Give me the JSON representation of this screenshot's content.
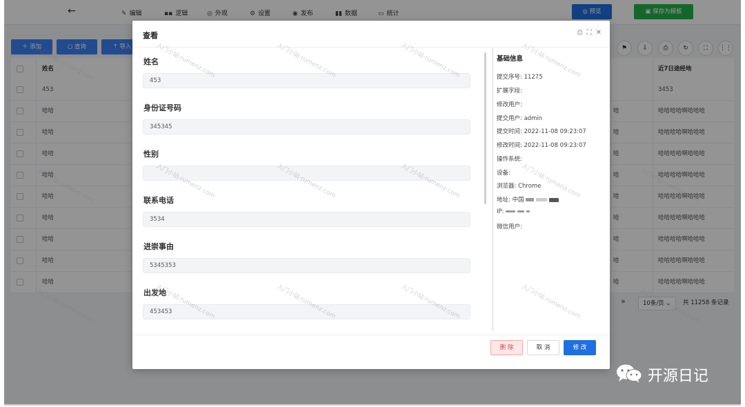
{
  "topbar": {
    "nav": [
      {
        "icon": "edit-icon",
        "glyph": "✎",
        "label": "编辑"
      },
      {
        "icon": "logic-icon",
        "glyph": "▪▪",
        "label": "逻辑"
      },
      {
        "icon": "eye-icon",
        "glyph": "◎",
        "label": "外观"
      },
      {
        "icon": "gear-icon",
        "glyph": "⚙",
        "label": "设置"
      },
      {
        "icon": "publish-icon",
        "glyph": "◉",
        "label": "发布"
      },
      {
        "icon": "bar-chart-icon",
        "glyph": "▮▮",
        "label": "数据"
      },
      {
        "icon": "stats-icon",
        "glyph": "▭",
        "label": "统计"
      }
    ],
    "preview_label": "预览",
    "save_template_label": "保存为模板"
  },
  "toolbar": {
    "add_label": "添加",
    "query_label": "查询",
    "import_label": "导入"
  },
  "table": {
    "col_name": "姓名",
    "col_route": "近7日途经地",
    "rows": [
      {
        "name": "453",
        "mid": "",
        "route": "3453"
      },
      {
        "name": "哈哈",
        "mid": "哈",
        "route": "哈哈哈哈啊哈哈哈"
      },
      {
        "name": "哈哈",
        "mid": "哈",
        "route": "哈哈哈哈啊哈哈哈"
      },
      {
        "name": "哈哈",
        "mid": "哈",
        "route": "哈哈哈哈啊哈哈哈"
      },
      {
        "name": "哈哈",
        "mid": "哈",
        "route": "哈哈哈哈啊哈哈哈"
      },
      {
        "name": "哈哈",
        "mid": "哈",
        "route": "哈哈哈哈啊哈哈哈"
      },
      {
        "name": "哈哈",
        "mid": "哈",
        "route": "哈哈哈哈啊哈哈哈"
      },
      {
        "name": "哈哈",
        "mid": "哈",
        "route": "哈哈哈哈啊哈哈哈"
      },
      {
        "name": "哈哈",
        "mid": "哈",
        "route": "哈哈哈哈啊哈哈哈"
      },
      {
        "name": "哈哈",
        "mid": "哈",
        "route": "哈哈哈哈啊哈哈哈"
      }
    ]
  },
  "pager": {
    "page_size": "10条/页",
    "total": "共 11258 条记录"
  },
  "modal": {
    "title": "查看",
    "fields": [
      {
        "label": "姓名",
        "value": "453"
      },
      {
        "label": "身份证号码",
        "value": "345345"
      },
      {
        "label": "性别",
        "value": ""
      },
      {
        "label": "联系电话",
        "value": "3534"
      },
      {
        "label": "进崇事由",
        "value": "5345353"
      },
      {
        "label": "出发地",
        "value": "453453"
      }
    ],
    "info_title": "基础信息",
    "info": {
      "submit_no": "提交序号:  11275",
      "ext_field": "扩展字段:",
      "modify_user": "修改用户:",
      "submit_user": "提交用户:  admin",
      "submit_time": "提交时间:  2022-11-08 09:23:07",
      "modify_time": "修改时间:  2022-11-08 09:23:07",
      "os": "操作系统:",
      "device": "设备:",
      "browser": "浏览器:  Chrome",
      "address": "地址:  中国",
      "ip": "IP:",
      "wechat_user": "微信用户:"
    },
    "delete_label": "删 除",
    "cancel_label": "取 消",
    "edit_label": "修 改"
  },
  "watermark": "入门小站·rumenz.com",
  "brand": {
    "text": "开源日记"
  }
}
